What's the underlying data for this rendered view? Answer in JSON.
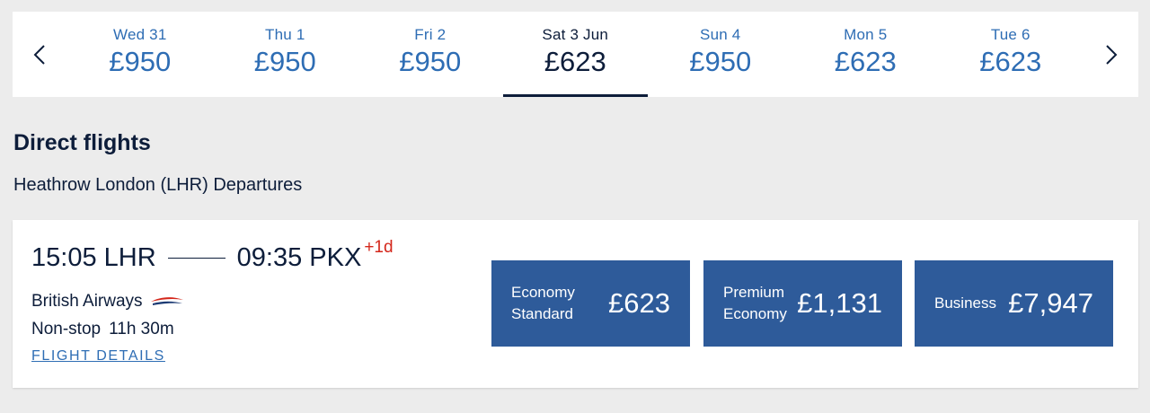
{
  "date_bar": {
    "tabs": [
      {
        "day": "Wed 31",
        "price": "£950"
      },
      {
        "day": "Thu 1",
        "price": "£950"
      },
      {
        "day": "Fri 2",
        "price": "£950"
      },
      {
        "day": "Sat 3 Jun",
        "price": "£623"
      },
      {
        "day": "Sun 4",
        "price": "£950"
      },
      {
        "day": "Mon 5",
        "price": "£623"
      },
      {
        "day": "Tue 6",
        "price": "£623"
      }
    ],
    "selected_index": 3,
    "prev_icon": "chevron-left-icon",
    "next_icon": "chevron-right-icon"
  },
  "section": {
    "title": "Direct flights",
    "departures": "Heathrow London (LHR) Departures"
  },
  "flight": {
    "depart": "15:05 LHR",
    "arrive": "09:35 PKX",
    "plus_day": "+1d",
    "airline": "British Airways",
    "airline_icon": "speedmarque-icon",
    "stops": "Non-stop",
    "duration": "11h 30m",
    "details_link": "FLIGHT DETAILS",
    "fares": [
      {
        "name_line1": "Economy",
        "name_line2": "Standard",
        "price": "£623"
      },
      {
        "name_line1": "Premium",
        "name_line2": "Economy",
        "price": "£1,131"
      },
      {
        "name_line1": "Business",
        "name_line2": "",
        "price": "£7,947"
      }
    ]
  },
  "colors": {
    "accent_blue": "#2e6db4",
    "navy": "#0d1d3a",
    "fare_button": "#2e5b9a",
    "plus_day_red": "#d4271b",
    "background": "#ececec"
  }
}
